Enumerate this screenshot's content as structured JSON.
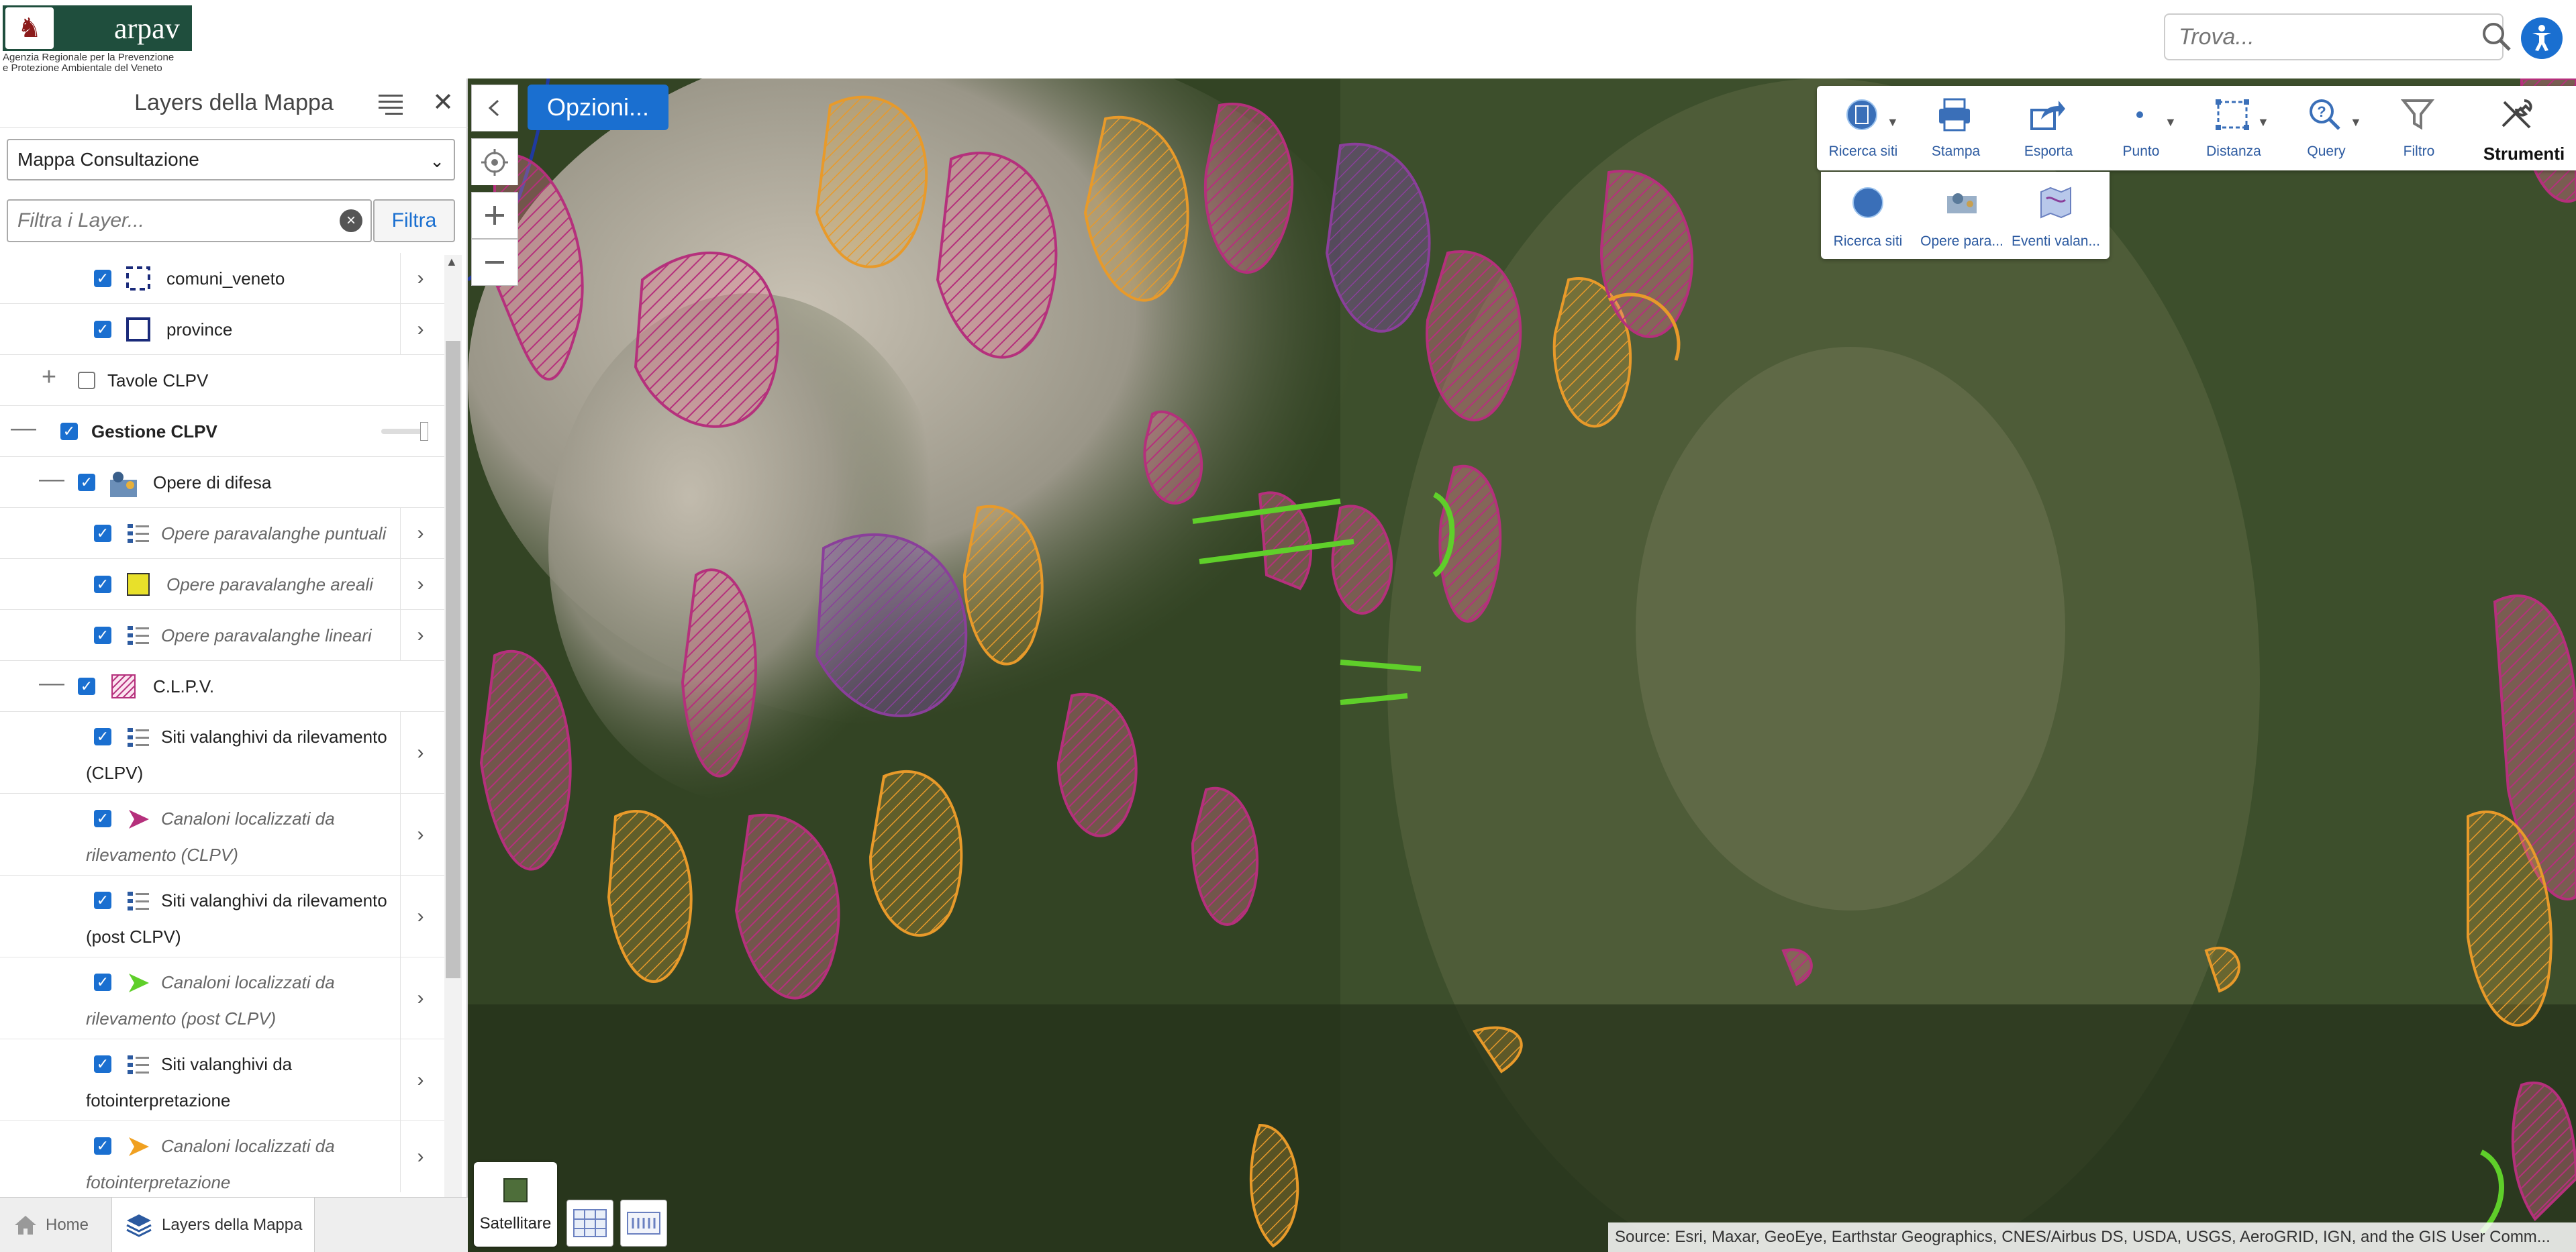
{
  "header": {
    "logo_brand": "arpav",
    "logo_subtitle_1": "Agenzia Regionale per la Prevenzione",
    "logo_subtitle_2": "e Protezione Ambientale del Veneto",
    "search_placeholder": "Trova..."
  },
  "sidebar": {
    "title": "Layers della Mappa",
    "map_select": "Mappa Consultazione",
    "filter_placeholder": "Filtra i Layer...",
    "filter_button": "Filtra",
    "layers": [
      {
        "label": "comuni_veneto",
        "checked": true
      },
      {
        "label": "province",
        "checked": true
      },
      {
        "label": "Tavole CLPV",
        "checked": false
      },
      {
        "label": "Gestione CLPV",
        "checked": true
      },
      {
        "label": "Opere di difesa",
        "checked": true
      },
      {
        "label": "Opere paravalanghe puntuali",
        "checked": true
      },
      {
        "label": "Opere paravalanghe areali",
        "checked": true
      },
      {
        "label": "Opere paravalanghe lineari",
        "checked": true
      },
      {
        "label": "C.L.P.V.",
        "checked": true
      },
      {
        "label_1": "Siti valanghivi da rilevamento",
        "label_2": "(CLPV)",
        "checked": true
      },
      {
        "label_1": "Canaloni localizzati da",
        "label_2": "rilevamento (CLPV)",
        "checked": true
      },
      {
        "label_1": "Siti valanghivi da rilevamento",
        "label_2": "(post CLPV)",
        "checked": true
      },
      {
        "label_1": "Canaloni localizzati da",
        "label_2": "rilevamento (post CLPV)",
        "checked": true
      },
      {
        "label_1": "Siti valanghivi da",
        "label_2": "fotointerpretazione",
        "checked": true
      },
      {
        "label_1": "Canaloni localizzati da",
        "label_2": "fotointerpretazione",
        "checked": true
      }
    ],
    "bottom_tabs": {
      "home": "Home",
      "layers": "Layers della Mappa"
    }
  },
  "map": {
    "options_button": "Opzioni...",
    "toolbar": {
      "ricerca_siti": "Ricerca siti",
      "stampa": "Stampa",
      "esporta": "Esporta",
      "punto": "Punto",
      "distanza": "Distanza",
      "query": "Query",
      "filtro": "Filtro",
      "strumenti": "Strumenti"
    },
    "subtoolbar": {
      "ricerca_siti": "Ricerca siti",
      "opere": "Opere para...",
      "eventi": "Eventi valan..."
    },
    "basemap_label": "Satellitare",
    "attribution": "Source: Esri, Maxar, GeoEye, Earthstar Geographics, CNES/Airbus DS, USDA, USGS, AeroGRID, IGN, and the GIS User Comm..."
  },
  "colors": {
    "accent": "#1a6fd0",
    "clpv_magenta": "#b5307c",
    "orange": "#e89a2a",
    "green": "#5fcf2a",
    "yellow": "#e8e02a"
  }
}
